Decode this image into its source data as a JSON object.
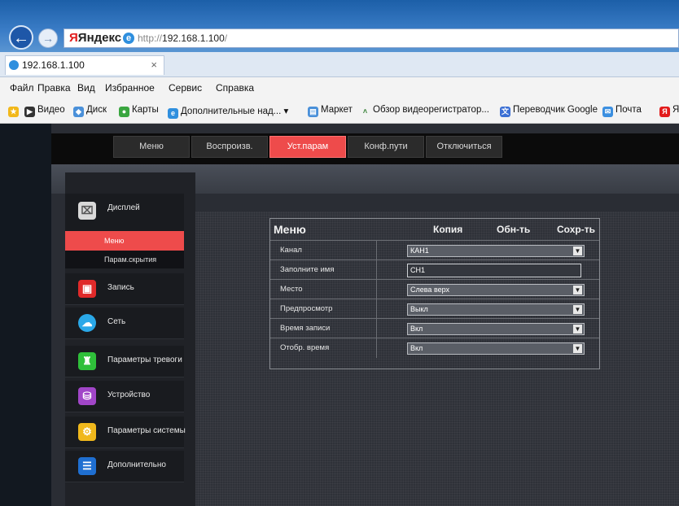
{
  "browser": {
    "search_brand": "Яндекс",
    "url_prefix": "http://",
    "url_host": "192.168.1.100",
    "url_suffix": "/",
    "tab_title": "192.168.1.100",
    "tab_close": "×"
  },
  "menubar": [
    "Файл",
    "Правка",
    "Вид",
    "Избранное",
    "Сервис",
    "Справка"
  ],
  "favorites": [
    {
      "label": "Видео",
      "icon": "video-icon"
    },
    {
      "label": "Диск",
      "icon": "disk-icon"
    },
    {
      "label": "Карты",
      "icon": "maps-icon"
    },
    {
      "label": "Дополнительные над... ▾",
      "icon": "ie-icon"
    },
    {
      "label": "Маркет",
      "icon": "market-icon"
    },
    {
      "label": "Обзор видеорегистратор...",
      "icon": "review-icon"
    },
    {
      "label": "Переводчик Google",
      "icon": "translate-icon"
    },
    {
      "label": "Почта",
      "icon": "mail-icon"
    },
    {
      "label": "Я",
      "icon": "yandex-icon"
    }
  ],
  "dvr": {
    "topnav": [
      {
        "label": "Меню",
        "active": false
      },
      {
        "label": "Воспроизв.",
        "active": false
      },
      {
        "label": "Уст.парам",
        "active": true
      },
      {
        "label": "Конф.пути",
        "active": false
      },
      {
        "label": "Отключиться",
        "active": false
      }
    ],
    "sidebar": {
      "display": "Дисплей",
      "sub_menu": "Меню",
      "sub_privacy": "Парам.скрытия",
      "record": "Запись",
      "network": "Сеть",
      "alarm": "Параметры тревоги",
      "device": "Устройство",
      "system": "Параметры системы",
      "advanced": "Дополнительно"
    },
    "panel": {
      "title": "Меню",
      "copy": "Копия",
      "refresh": "Обн-ть",
      "save": "Сохр-ть",
      "rows": {
        "channel": {
          "label": "Канал",
          "value": "КАН1"
        },
        "name": {
          "label": "Заполните имя",
          "value": "CH1"
        },
        "position": {
          "label": "Место",
          "value": "Слева верх"
        },
        "preview": {
          "label": "Предпросмотр",
          "value": "Выкл"
        },
        "rec_time": {
          "label": "Время записи",
          "value": "Вкл"
        },
        "show_time": {
          "label": "Отобр. время",
          "value": "Вкл"
        }
      }
    }
  },
  "colors": {
    "accent_red": "#ee4b4b",
    "panel_bg": "#2f3239",
    "browser_blue": "#2a6bb6"
  }
}
